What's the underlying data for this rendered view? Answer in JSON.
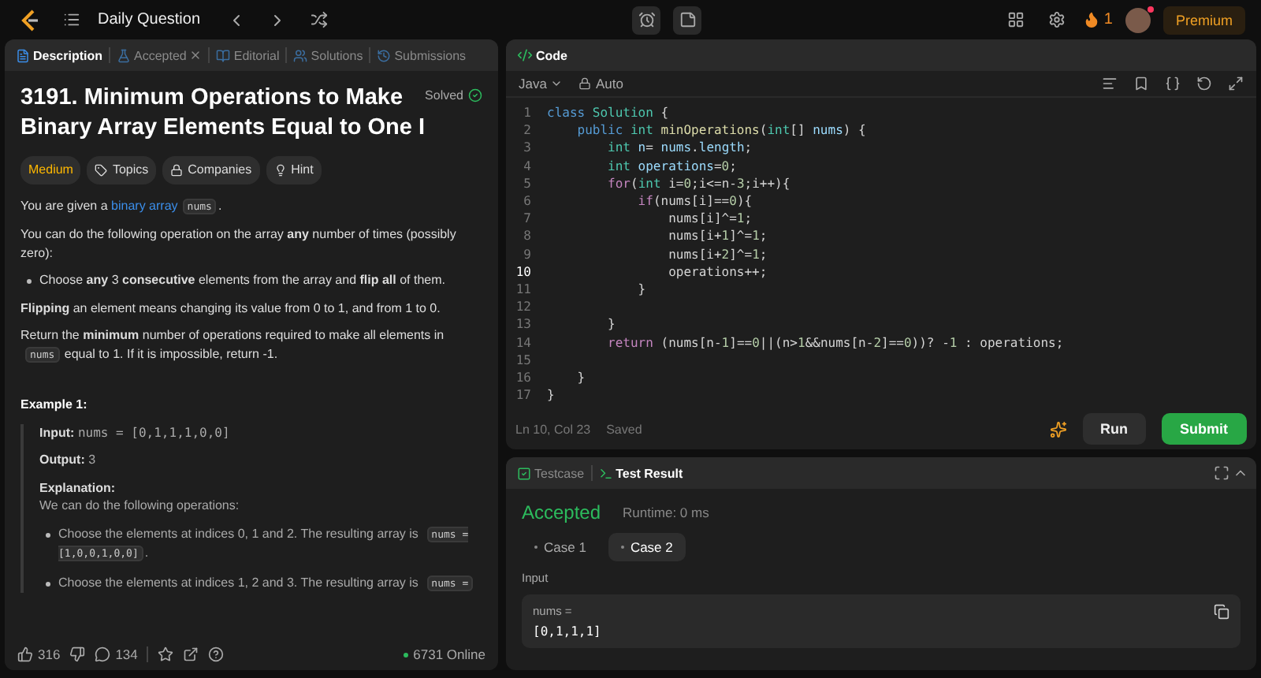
{
  "topbar": {
    "title": "Daily Question",
    "streak": "1",
    "premium": "Premium"
  },
  "left_tabs": [
    {
      "label": "Description",
      "selected": true,
      "closable": false
    },
    {
      "label": "Accepted",
      "selected": false,
      "closable": true
    },
    {
      "label": "Editorial",
      "selected": false,
      "closable": false
    },
    {
      "label": "Solutions",
      "selected": false,
      "closable": false
    },
    {
      "label": "Submissions",
      "selected": false,
      "closable": false
    }
  ],
  "problem": {
    "title": "3191. Minimum Operations to Make Binary Array Elements Equal to One I",
    "status": "Solved",
    "difficulty": "Medium",
    "chips": [
      "Topics",
      "Companies",
      "Hint"
    ],
    "blocks": [
      {
        "kind": "p",
        "parts": [
          {
            "kind": "text",
            "text": "You are given a "
          },
          {
            "kind": "link",
            "text": "binary array"
          },
          {
            "kind": "code",
            "text": "nums"
          },
          {
            "kind": "text",
            "text": "."
          }
        ]
      },
      {
        "kind": "p",
        "parts": [
          {
            "kind": "text",
            "text": "You can do the following operation on the array **any** number of times (possibly zero):"
          }
        ]
      },
      {
        "kind": "bullet",
        "parts": [
          {
            "kind": "text",
            "text": "Choose **any** 3 **consecutive** elements from the array and **flip all** of them."
          }
        ]
      },
      {
        "kind": "p",
        "parts": [
          {
            "kind": "text",
            "text": "**Flipping** an element means changing its value from 0 to 1, and from 1 to 0."
          }
        ]
      },
      {
        "kind": "p",
        "parts": [
          {
            "kind": "text",
            "text": "Return the **minimum** number of operations required to make all elements in "
          },
          {
            "kind": "code",
            "text": "nums"
          },
          {
            "kind": "text",
            "text": " equal to 1. If it is impossible, return -1."
          }
        ]
      },
      {
        "kind": "heading",
        "parts": [
          {
            "kind": "text",
            "text": "Example 1:"
          }
        ]
      },
      {
        "kind": "example",
        "input_label": "Input:",
        "input": "nums = [0,1,1,1,0,0]",
        "output_label": "Output:",
        "output": "3",
        "explanation_label": "Explanation:",
        "explanation": "We can do the following operations:",
        "bullets": [
          [
            {
              "kind": "text",
              "text": "Choose the elements at indices 0, 1 and 2. The resulting array is "
            },
            {
              "kind": "code",
              "text": "nums = [1,0,0,1,0,0]"
            },
            {
              "kind": "text",
              "text": "."
            }
          ],
          [
            {
              "kind": "text",
              "text": "Choose the elements at indices 1, 2 and 3. The resulting array is "
            },
            {
              "kind": "code",
              "text": "nums ="
            }
          ]
        ]
      }
    ]
  },
  "left_footer": {
    "likes": "316",
    "comments": "134",
    "online": "6731 Online"
  },
  "editor": {
    "title": "Code",
    "language": "Java",
    "mode": "Auto",
    "lines": [
      {
        "number": "1",
        "current": false,
        "tokens": [
          {
            "kind": "kw",
            "text": "class"
          },
          {
            "kind": "cls",
            "text": " Solution"
          },
          {
            "kind": "p",
            "text": " {"
          }
        ]
      },
      {
        "number": "2",
        "current": false,
        "tokens": [
          {
            "kind": "kw",
            "text": "    public"
          },
          {
            "kind": "type",
            "text": " int"
          },
          {
            "kind": "fn",
            "text": " minOperations"
          },
          {
            "kind": "p",
            "text": "("
          },
          {
            "kind": "type",
            "text": "int"
          },
          {
            "kind": "p",
            "text": "[]"
          },
          {
            "kind": "var",
            "text": " nums"
          },
          {
            "kind": "p",
            "text": ") {"
          }
        ]
      },
      {
        "number": "3",
        "current": false,
        "tokens": [
          {
            "kind": "type",
            "text": "        int"
          },
          {
            "kind": "var",
            "text": " n"
          },
          {
            "kind": "p",
            "text": "="
          },
          {
            "kind": "var",
            "text": " nums"
          },
          {
            "kind": "p",
            "text": "."
          },
          {
            "kind": "var",
            "text": "length"
          },
          {
            "kind": "p",
            "text": ";"
          }
        ]
      },
      {
        "number": "4",
        "current": false,
        "tokens": [
          {
            "kind": "type",
            "text": "        int"
          },
          {
            "kind": "var",
            "text": " operations"
          },
          {
            "kind": "p",
            "text": "="
          },
          {
            "kind": "num",
            "text": "0"
          },
          {
            "kind": "p",
            "text": ";"
          }
        ]
      },
      {
        "number": "5",
        "current": false,
        "tokens": [
          {
            "kind": "ctrl",
            "text": "        for"
          },
          {
            "kind": "p",
            "text": "("
          },
          {
            "kind": "type",
            "text": "int"
          },
          {
            "kind": "p",
            "text": " i="
          },
          {
            "kind": "num",
            "text": "0"
          },
          {
            "kind": "p",
            "text": ";i<=n-"
          },
          {
            "kind": "num",
            "text": "3"
          },
          {
            "kind": "p",
            "text": ";i++){"
          }
        ]
      },
      {
        "number": "6",
        "current": false,
        "tokens": [
          {
            "kind": "ctrl",
            "text": "            if"
          },
          {
            "kind": "p",
            "text": "(nums[i]=="
          },
          {
            "kind": "num",
            "text": "0"
          },
          {
            "kind": "p",
            "text": "){"
          }
        ]
      },
      {
        "number": "7",
        "current": false,
        "tokens": [
          {
            "kind": "p",
            "text": "                nums[i]^="
          },
          {
            "kind": "num",
            "text": "1"
          },
          {
            "kind": "p",
            "text": ";"
          }
        ]
      },
      {
        "number": "8",
        "current": false,
        "tokens": [
          {
            "kind": "p",
            "text": "                nums[i+"
          },
          {
            "kind": "num",
            "text": "1"
          },
          {
            "kind": "p",
            "text": "]^="
          },
          {
            "kind": "num",
            "text": "1"
          },
          {
            "kind": "p",
            "text": ";"
          }
        ]
      },
      {
        "number": "9",
        "current": false,
        "tokens": [
          {
            "kind": "p",
            "text": "                nums[i+"
          },
          {
            "kind": "num",
            "text": "2"
          },
          {
            "kind": "p",
            "text": "]^="
          },
          {
            "kind": "num",
            "text": "1"
          },
          {
            "kind": "p",
            "text": ";"
          }
        ]
      },
      {
        "number": "10",
        "current": true,
        "tokens": [
          {
            "kind": "p",
            "text": "                operations++;"
          }
        ]
      },
      {
        "number": "11",
        "current": false,
        "tokens": [
          {
            "kind": "p",
            "text": "            }"
          }
        ]
      },
      {
        "number": "12",
        "current": false
      },
      {
        "number": "13",
        "current": false,
        "tokens": [
          {
            "kind": "p",
            "text": "        }"
          }
        ]
      },
      {
        "number": "14",
        "current": false,
        "tokens": [
          {
            "kind": "ctrl",
            "text": "        return"
          },
          {
            "kind": "p",
            "text": " (nums[n-"
          },
          {
            "kind": "num",
            "text": "1"
          },
          {
            "kind": "p",
            "text": "]=="
          },
          {
            "kind": "num",
            "text": "0"
          },
          {
            "kind": "p",
            "text": "||(n>"
          },
          {
            "kind": "num",
            "text": "1"
          },
          {
            "kind": "p",
            "text": "&&nums[n-"
          },
          {
            "kind": "num",
            "text": "2"
          },
          {
            "kind": "p",
            "text": "]=="
          },
          {
            "kind": "num",
            "text": "0"
          },
          {
            "kind": "p",
            "text": "))? -"
          },
          {
            "kind": "num",
            "text": "1"
          },
          {
            "kind": "p",
            "text": " : operations;"
          }
        ]
      },
      {
        "number": "15",
        "current": false
      },
      {
        "number": "16",
        "current": false,
        "tokens": [
          {
            "kind": "p",
            "text": "    }"
          }
        ]
      },
      {
        "number": "17",
        "current": false,
        "tokens": [
          {
            "kind": "p",
            "text": "}"
          }
        ]
      }
    ],
    "cursor": "Ln 10, Col 23",
    "save_state": "Saved",
    "run": "Run",
    "submit": "Submit"
  },
  "result": {
    "tabs": [
      {
        "label": "Testcase",
        "selected": false
      },
      {
        "label": "Test Result",
        "selected": true
      }
    ],
    "verdict": "Accepted",
    "runtime": "Runtime: 0 ms",
    "cases": [
      {
        "label": "Case 1",
        "selected": false
      },
      {
        "label": "Case 2",
        "selected": true
      }
    ],
    "input_label": "Input",
    "var_label": "nums =",
    "value": "[0,1,1,1]"
  }
}
